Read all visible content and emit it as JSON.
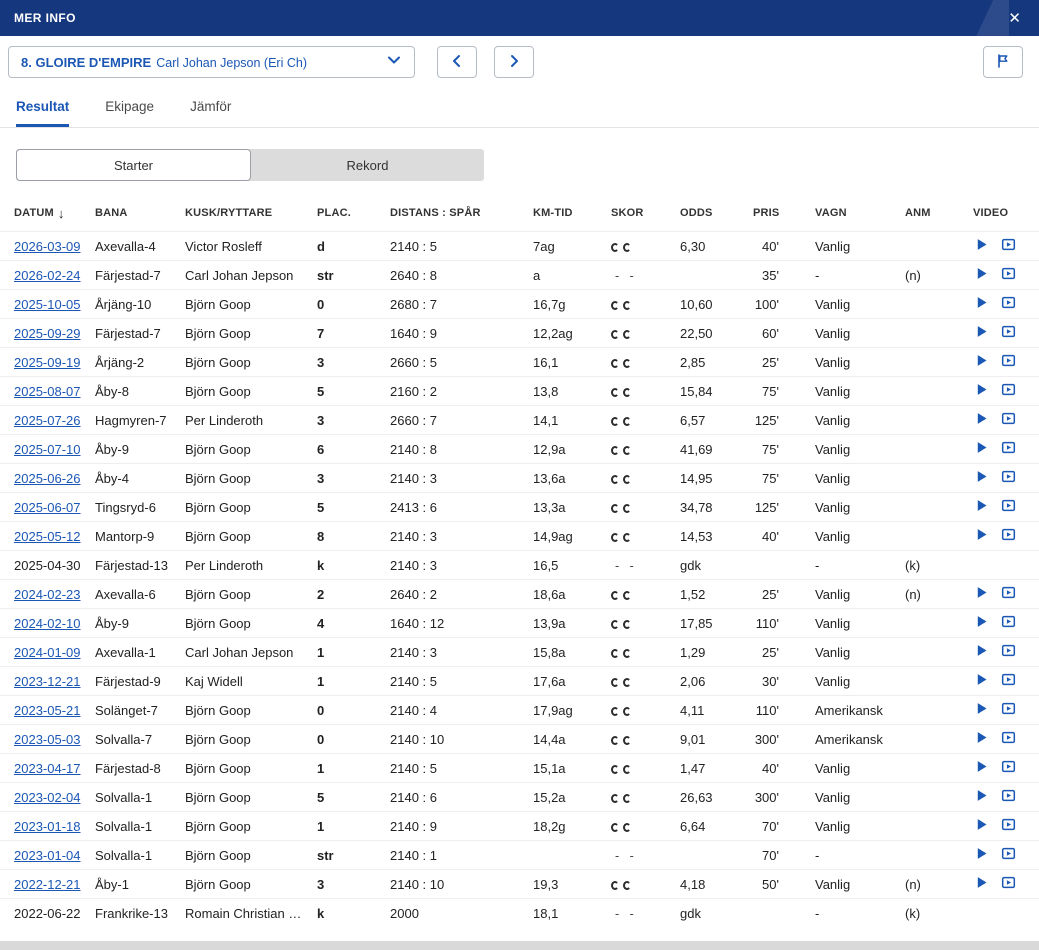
{
  "header": {
    "title": "MER INFO",
    "close_icon": "✕"
  },
  "selector": {
    "horse": "8. GLOIRE D'EMPIRE",
    "driver": "Carl Johan Jepson (Eri Ch)"
  },
  "tabs": [
    {
      "label": "Resultat",
      "active": true
    },
    {
      "label": "Ekipage",
      "active": false
    },
    {
      "label": "Jämför",
      "active": false
    }
  ],
  "segmented": [
    {
      "label": "Starter",
      "active": true
    },
    {
      "label": "Rekord",
      "active": false
    }
  ],
  "table": {
    "columns": [
      "DATUM",
      "BANA",
      "KUSK/RYTTARE",
      "PLAC.",
      "DISTANS : SPÅR",
      "KM-TID",
      "SKOR",
      "ODDS",
      "PRIS",
      "VAGN",
      "ANM",
      "VIDEO"
    ],
    "sort_icon": "↓",
    "rows": [
      {
        "datum": "2026-03-09",
        "link": true,
        "bana": "Axevalla-4",
        "kusk": "Victor Rosleff",
        "plac": "d",
        "distans": "2140 : 5",
        "kmtid": "7ag",
        "skor": "shoes",
        "odds": "6,30",
        "pris": "40'",
        "vagn": "Vanlig",
        "anm": "",
        "video": true
      },
      {
        "datum": "2026-02-24",
        "link": true,
        "bana": "Färjestad-7",
        "kusk": "Carl Johan Jepson",
        "plac": "str",
        "distans": "2640 : 8",
        "kmtid": "a",
        "skor": "dashes",
        "odds": "",
        "pris": "35'",
        "vagn": "-",
        "anm": "(n)",
        "video": true
      },
      {
        "datum": "2025-10-05",
        "link": true,
        "bana": "Årjäng-10",
        "kusk": "Björn Goop",
        "plac": "0",
        "distans": "2680 : 7",
        "kmtid": "16,7g",
        "skor": "shoes",
        "odds": "10,60",
        "pris": "100'",
        "vagn": "Vanlig",
        "anm": "",
        "video": true
      },
      {
        "datum": "2025-09-29",
        "link": true,
        "bana": "Färjestad-7",
        "kusk": "Björn Goop",
        "plac": "7",
        "distans": "1640 : 9",
        "kmtid": "12,2ag",
        "skor": "shoes",
        "odds": "22,50",
        "pris": "60'",
        "vagn": "Vanlig",
        "anm": "",
        "video": true
      },
      {
        "datum": "2025-09-19",
        "link": true,
        "bana": "Årjäng-2",
        "kusk": "Björn Goop",
        "plac": "3",
        "distans": "2660 : 5",
        "kmtid": "16,1",
        "skor": "shoes",
        "odds": "2,85",
        "pris": "25'",
        "vagn": "Vanlig",
        "anm": "",
        "video": true
      },
      {
        "datum": "2025-08-07",
        "link": true,
        "bana": "Åby-8",
        "kusk": "Björn Goop",
        "plac": "5",
        "distans": "2160 : 2",
        "kmtid": "13,8",
        "skor": "shoes",
        "odds": "15,84",
        "pris": "75'",
        "vagn": "Vanlig",
        "anm": "",
        "video": true
      },
      {
        "datum": "2025-07-26",
        "link": true,
        "bana": "Hagmyren-7",
        "kusk": "Per Linderoth",
        "plac": "3",
        "distans": "2660 : 7",
        "kmtid": "14,1",
        "skor": "shoes",
        "odds": "6,57",
        "pris": "125'",
        "vagn": "Vanlig",
        "anm": "",
        "video": true
      },
      {
        "datum": "2025-07-10",
        "link": true,
        "bana": "Åby-9",
        "kusk": "Björn Goop",
        "plac": "6",
        "distans": "2140 : 8",
        "kmtid": "12,9a",
        "skor": "shoes",
        "odds": "41,69",
        "pris": "75'",
        "vagn": "Vanlig",
        "anm": "",
        "video": true
      },
      {
        "datum": "2025-06-26",
        "link": true,
        "bana": "Åby-4",
        "kusk": "Björn Goop",
        "plac": "3",
        "distans": "2140 : 3",
        "kmtid": "13,6a",
        "skor": "shoes",
        "odds": "14,95",
        "pris": "75'",
        "vagn": "Vanlig",
        "anm": "",
        "video": true
      },
      {
        "datum": "2025-06-07",
        "link": true,
        "bana": "Tingsryd-6",
        "kusk": "Björn Goop",
        "plac": "5",
        "distans": "2413 : 6",
        "kmtid": "13,3a",
        "skor": "shoes",
        "odds": "34,78",
        "pris": "125'",
        "vagn": "Vanlig",
        "anm": "",
        "video": true
      },
      {
        "datum": "2025-05-12",
        "link": true,
        "bana": "Mantorp-9",
        "kusk": "Björn Goop",
        "plac": "8",
        "distans": "2140 : 3",
        "kmtid": "14,9ag",
        "skor": "shoes",
        "odds": "14,53",
        "pris": "40'",
        "vagn": "Vanlig",
        "anm": "",
        "video": true
      },
      {
        "datum": "2025-04-30",
        "link": false,
        "bana": "Färjestad-13",
        "kusk": "Per Linderoth",
        "plac": "k",
        "distans": "2140 : 3",
        "kmtid": "16,5",
        "skor": "dashes",
        "odds": "gdk",
        "pris": "",
        "vagn": "-",
        "anm": "(k)",
        "video": false
      },
      {
        "datum": "2024-02-23",
        "link": true,
        "bana": "Axevalla-6",
        "kusk": "Björn Goop",
        "plac": "2",
        "distans": "2640 : 2",
        "kmtid": "18,6a",
        "skor": "shoes",
        "odds": "1,52",
        "pris": "25'",
        "vagn": "Vanlig",
        "anm": "(n)",
        "video": true
      },
      {
        "datum": "2024-02-10",
        "link": true,
        "bana": "Åby-9",
        "kusk": "Björn Goop",
        "plac": "4",
        "distans": "1640 : 12",
        "kmtid": "13,9a",
        "skor": "shoes",
        "odds": "17,85",
        "pris": "110'",
        "vagn": "Vanlig",
        "anm": "",
        "video": true
      },
      {
        "datum": "2024-01-09",
        "link": true,
        "bana": "Axevalla-1",
        "kusk": "Carl Johan Jepson",
        "plac": "1",
        "distans": "2140 : 3",
        "kmtid": "15,8a",
        "skor": "shoes",
        "odds": "1,29",
        "pris": "25'",
        "vagn": "Vanlig",
        "anm": "",
        "video": true
      },
      {
        "datum": "2023-12-21",
        "link": true,
        "bana": "Färjestad-9",
        "kusk": "Kaj Widell",
        "plac": "1",
        "distans": "2140 : 5",
        "kmtid": "17,6a",
        "skor": "shoes",
        "odds": "2,06",
        "pris": "30'",
        "vagn": "Vanlig",
        "anm": "",
        "video": true
      },
      {
        "datum": "2023-05-21",
        "link": true,
        "bana": "Solänget-7",
        "kusk": "Björn Goop",
        "plac": "0",
        "distans": "2140 : 4",
        "kmtid": "17,9ag",
        "skor": "shoes",
        "odds": "4,11",
        "pris": "110'",
        "vagn": "Amerikansk",
        "anm": "",
        "video": true
      },
      {
        "datum": "2023-05-03",
        "link": true,
        "bana": "Solvalla-7",
        "kusk": "Björn Goop",
        "plac": "0",
        "distans": "2140 : 10",
        "kmtid": "14,4a",
        "skor": "shoes",
        "odds": "9,01",
        "pris": "300'",
        "vagn": "Amerikansk",
        "anm": "",
        "video": true
      },
      {
        "datum": "2023-04-17",
        "link": true,
        "bana": "Färjestad-8",
        "kusk": "Björn Goop",
        "plac": "1",
        "distans": "2140 : 5",
        "kmtid": "15,1a",
        "skor": "shoes",
        "odds": "1,47",
        "pris": "40'",
        "vagn": "Vanlig",
        "anm": "",
        "video": true
      },
      {
        "datum": "2023-02-04",
        "link": true,
        "bana": "Solvalla-1",
        "kusk": "Björn Goop",
        "plac": "5",
        "distans": "2140 : 6",
        "kmtid": "15,2a",
        "skor": "shoes",
        "odds": "26,63",
        "pris": "300'",
        "vagn": "Vanlig",
        "anm": "",
        "video": true
      },
      {
        "datum": "2023-01-18",
        "link": true,
        "bana": "Solvalla-1",
        "kusk": "Björn Goop",
        "plac": "1",
        "distans": "2140 : 9",
        "kmtid": "18,2g",
        "skor": "shoes",
        "odds": "6,64",
        "pris": "70'",
        "vagn": "Vanlig",
        "anm": "",
        "video": true
      },
      {
        "datum": "2023-01-04",
        "link": true,
        "bana": "Solvalla-1",
        "kusk": "Björn Goop",
        "plac": "str",
        "distans": "2140 : 1",
        "kmtid": "",
        "skor": "dashes",
        "odds": "",
        "pris": "70'",
        "vagn": "-",
        "anm": "",
        "video": true
      },
      {
        "datum": "2022-12-21",
        "link": true,
        "bana": "Åby-1",
        "kusk": "Björn Goop",
        "plac": "3",
        "distans": "2140 : 10",
        "kmtid": "19,3",
        "skor": "shoes",
        "odds": "4,18",
        "pris": "50'",
        "vagn": "Vanlig",
        "anm": "(n)",
        "video": true
      },
      {
        "datum": "2022-06-22",
        "link": false,
        "bana": "Frankrike-13",
        "kusk": "Romain Christian …",
        "plac": "k",
        "distans": "2000",
        "kmtid": "18,1",
        "skor": "dashes",
        "odds": "gdk",
        "pris": "",
        "vagn": "-",
        "anm": "(k)",
        "video": false
      }
    ]
  }
}
